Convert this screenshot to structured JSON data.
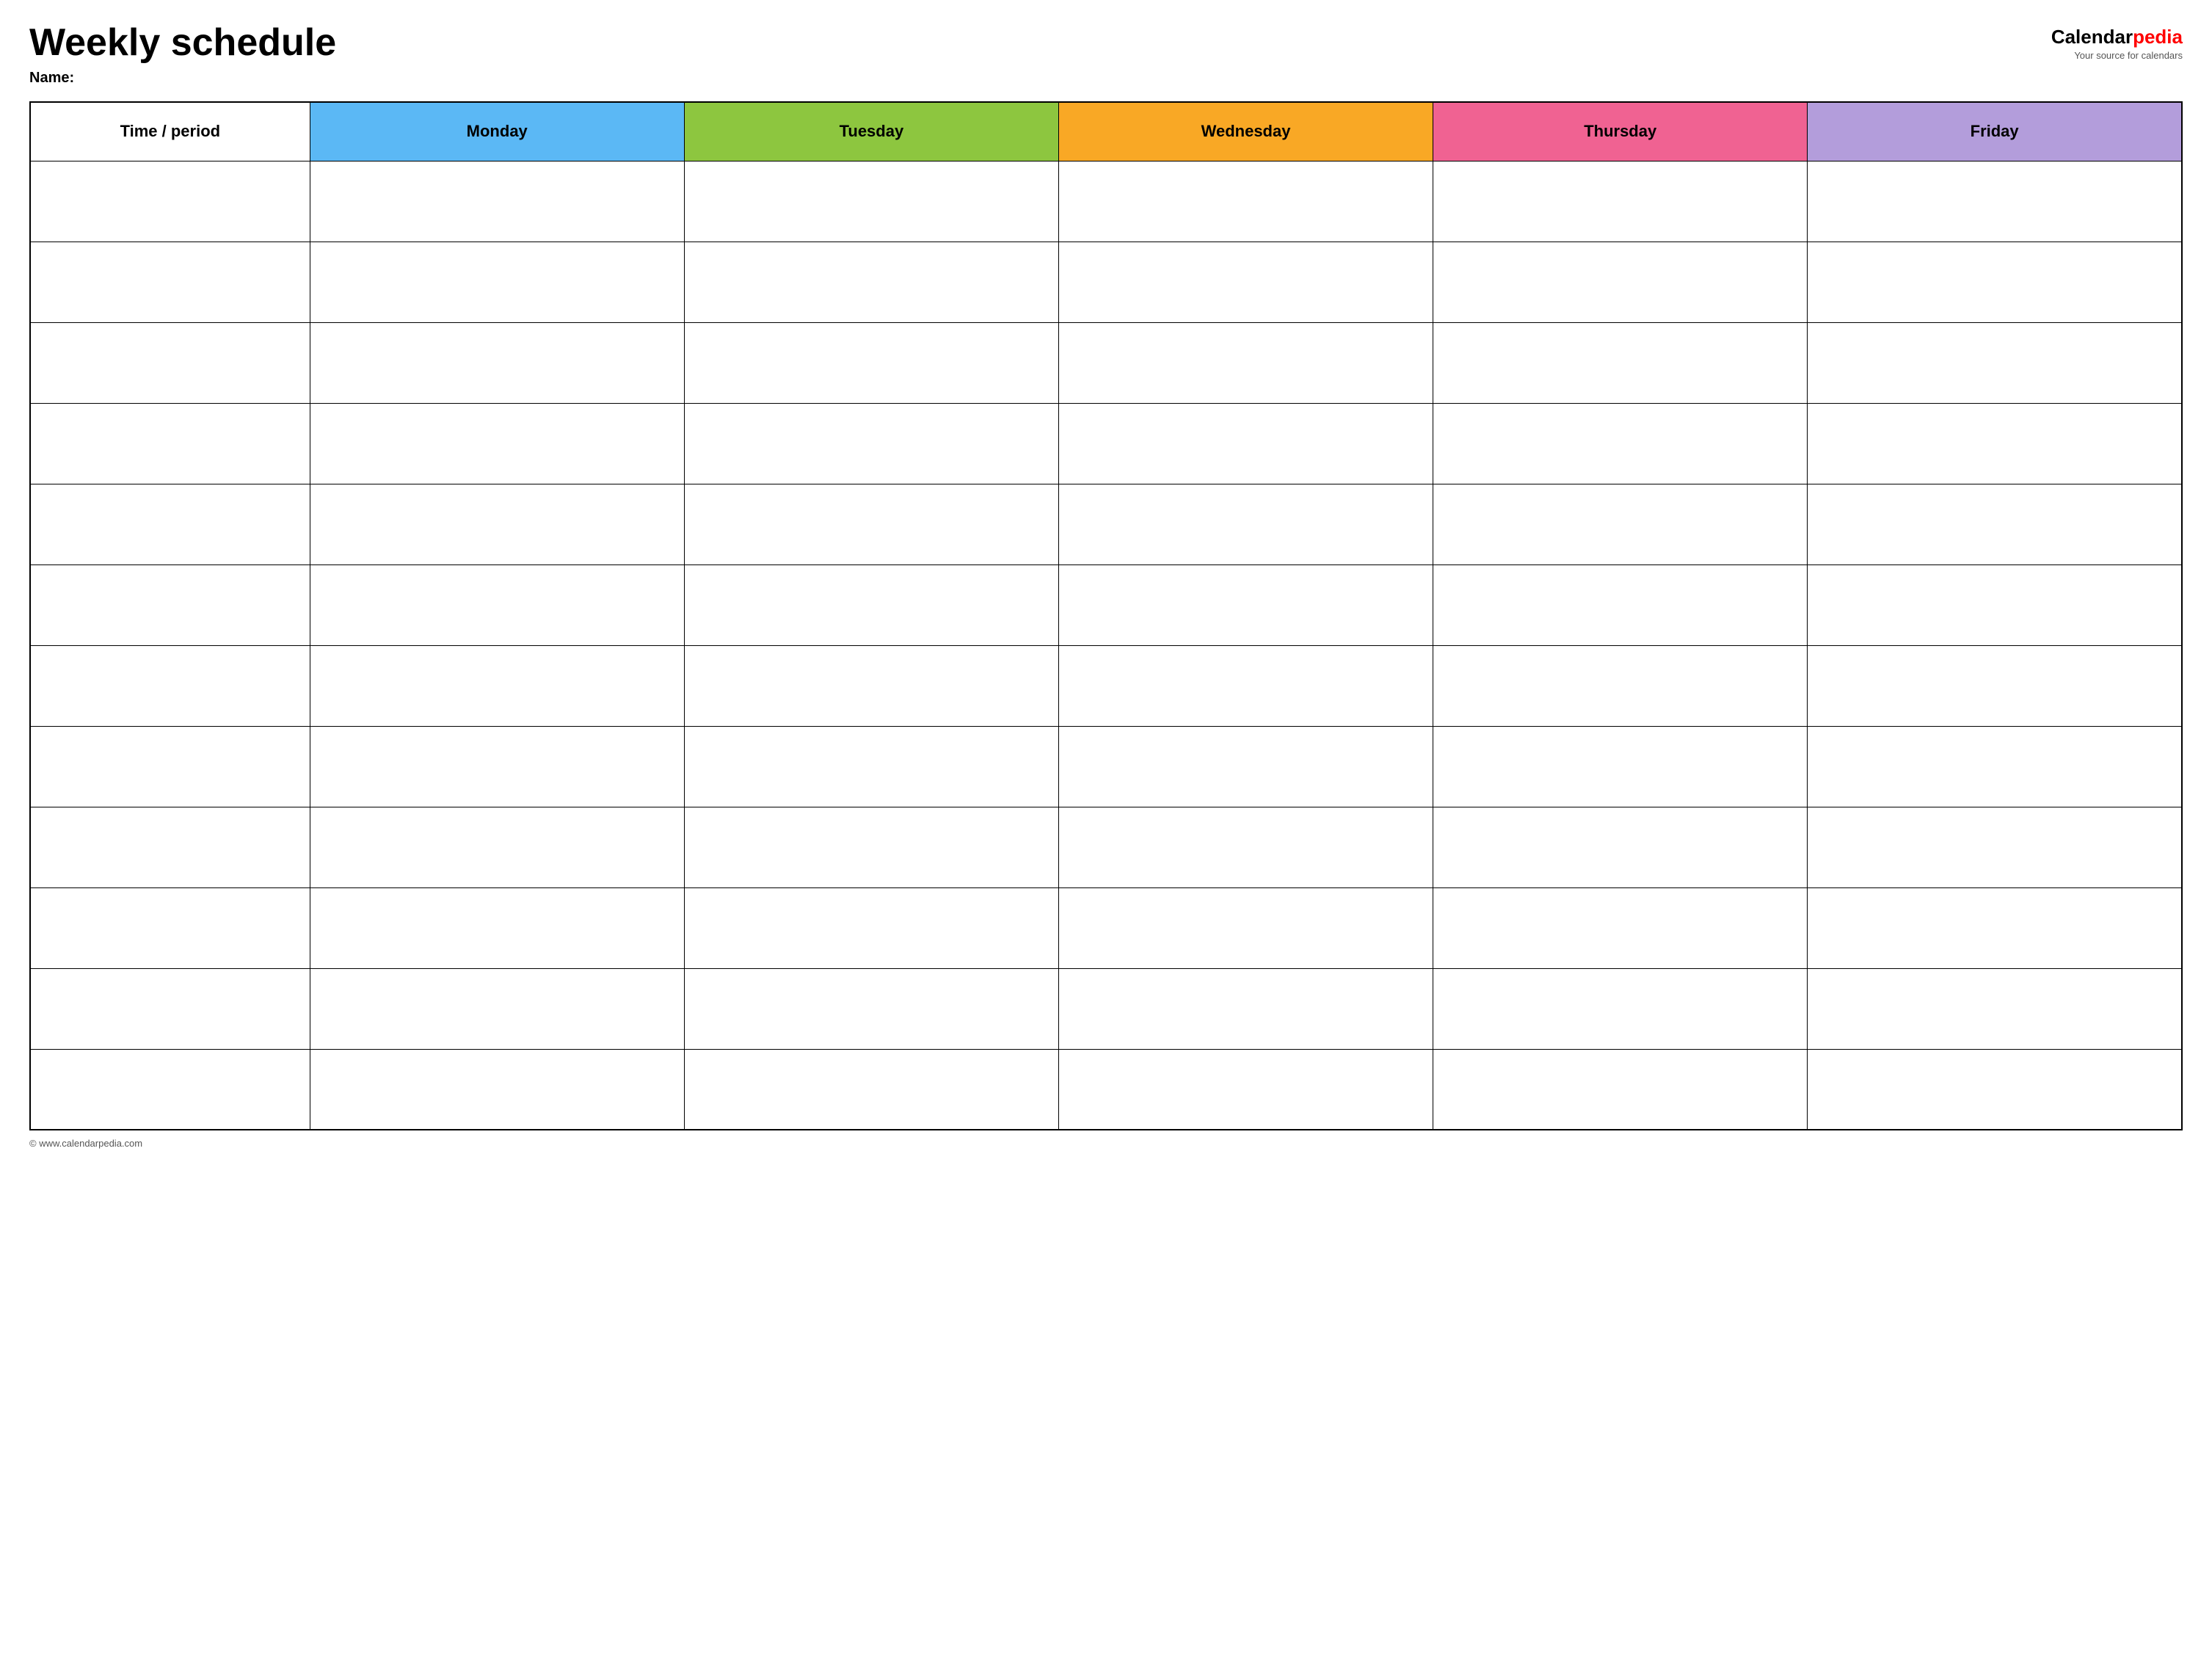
{
  "header": {
    "title": "Weekly schedule",
    "name_label": "Name:",
    "logo": {
      "calendar_part": "Calendar",
      "pedia_part": "pedia",
      "tagline": "Your source for calendars"
    }
  },
  "table": {
    "columns": [
      {
        "key": "time",
        "label": "Time / period",
        "color": "#ffffff",
        "class": "th-time"
      },
      {
        "key": "monday",
        "label": "Monday",
        "color": "#5bb8f5",
        "class": "th-monday"
      },
      {
        "key": "tuesday",
        "label": "Tuesday",
        "color": "#8dc63f",
        "class": "th-tuesday"
      },
      {
        "key": "wednesday",
        "label": "Wednesday",
        "color": "#f9a825",
        "class": "th-wednesday"
      },
      {
        "key": "thursday",
        "label": "Thursday",
        "color": "#f06292",
        "class": "th-thursday"
      },
      {
        "key": "friday",
        "label": "Friday",
        "color": "#b39ddb",
        "class": "th-friday"
      }
    ],
    "row_count": 12
  },
  "footer": {
    "url": "© www.calendarpedia.com"
  }
}
